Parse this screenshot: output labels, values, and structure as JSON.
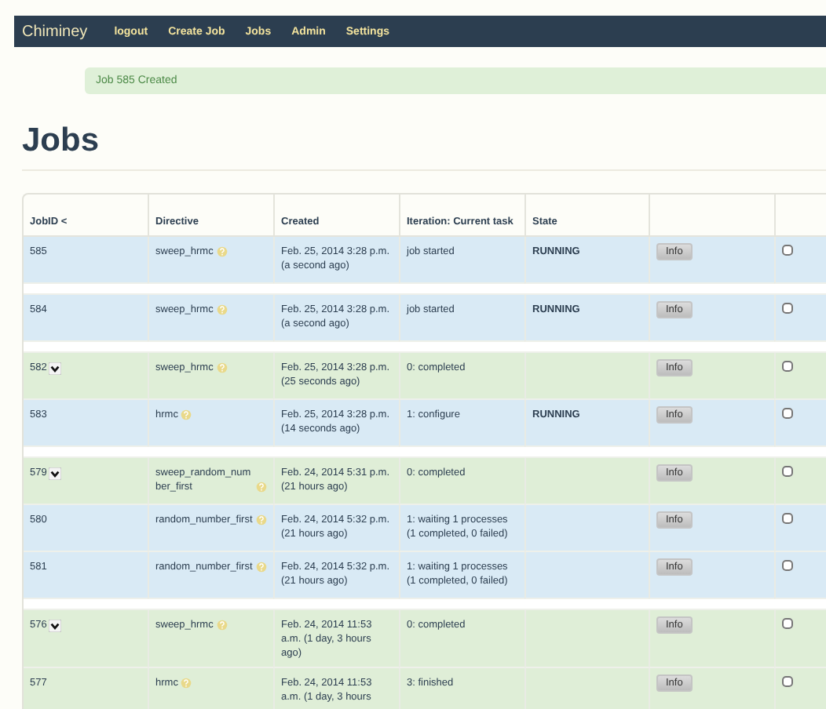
{
  "navbar": {
    "brand": "Chiminey",
    "links": [
      "logout",
      "Create Job",
      "Jobs",
      "Admin",
      "Settings"
    ]
  },
  "alert": {
    "message": "Job 585 Created"
  },
  "heading": "Jobs",
  "table": {
    "columns": [
      "JobID <",
      "Directive",
      "Created",
      "Iteration: Current task",
      "State"
    ],
    "groups": [
      {
        "rows": [
          {
            "id": "585",
            "expander": false,
            "directive": "sweep_hrmc",
            "created": "Feb. 25, 2014 3:28 p.m. (a second ago)",
            "iteration": "job started",
            "state": "RUNNING",
            "button": "Info",
            "checked": false,
            "color": "#d9eaf5"
          }
        ]
      },
      {
        "rows": [
          {
            "id": "584",
            "expander": false,
            "directive": "sweep_hrmc",
            "created": "Feb. 25, 2014 3:28 p.m. (a second ago)",
            "iteration": "job started",
            "state": "RUNNING",
            "button": "Info",
            "checked": false,
            "color": "#d9eaf5"
          }
        ]
      },
      {
        "rows": [
          {
            "id": "582",
            "expander": true,
            "directive": "sweep_hrmc",
            "created": "Feb. 25, 2014 3:28 p.m. (25 seconds ago)",
            "iteration": "0: completed",
            "state": "",
            "button": "Info",
            "checked": false,
            "color": "#dfeed7"
          },
          {
            "id": "583",
            "expander": false,
            "directive": "hrmc",
            "created": "Feb. 25, 2014 3:28 p.m. (14 seconds ago)",
            "iteration": "1: configure",
            "state": "RUNNING",
            "button": "Info",
            "checked": false,
            "color": "#d9eaf5"
          }
        ]
      },
      {
        "rows": [
          {
            "id": "579",
            "expander": true,
            "directive": "sweep_random_number_first",
            "created": "Feb. 24, 2014 5:31 p.m. (21 hours ago)",
            "iteration": "0: completed",
            "state": "",
            "button": "Info",
            "checked": false,
            "color": "#dfeed7"
          },
          {
            "id": "580",
            "expander": false,
            "directive": "random_number_first",
            "created": "Feb. 24, 2014 5:32 p.m. (21 hours ago)",
            "iteration": "1: waiting 1 processes (1 completed, 0 failed)",
            "state": "",
            "button": "Info",
            "checked": false,
            "color": "#d9eaf5"
          },
          {
            "id": "581",
            "expander": false,
            "directive": "random_number_first",
            "created": "Feb. 24, 2014 5:32 p.m. (21 hours ago)",
            "iteration": "1: waiting 1 processes (1 completed, 0 failed)",
            "state": "",
            "button": "Info",
            "checked": false,
            "color": "#d9eaf5"
          }
        ]
      },
      {
        "rows": [
          {
            "id": "576",
            "expander": true,
            "directive": "sweep_hrmc",
            "created": "Feb. 24, 2014 11:53 a.m. (1 day, 3 hours ago)",
            "iteration": "0: completed",
            "state": "",
            "button": "Info",
            "checked": false,
            "color": "#dfeed7"
          },
          {
            "id": "577",
            "expander": false,
            "directive": "hrmc",
            "created": "Feb. 24, 2014 11:53 a.m. (1 day, 3 hours",
            "iteration": "3: finished",
            "state": "",
            "button": "Info",
            "checked": false,
            "color": "#dfeed7"
          }
        ]
      }
    ]
  }
}
